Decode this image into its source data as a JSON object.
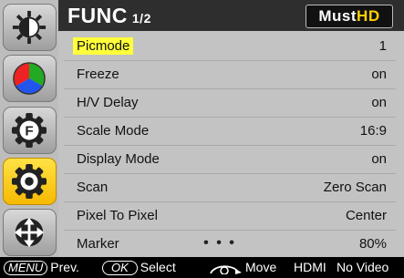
{
  "header": {
    "title": "FUNC",
    "page": "1/2",
    "logo_must": "Must",
    "logo_hd": "HD"
  },
  "sidebar": {
    "items": [
      {
        "icon": "brightness-icon",
        "active": false
      },
      {
        "icon": "color-wheel-icon",
        "active": false
      },
      {
        "icon": "function-gear-icon",
        "active": false
      },
      {
        "icon": "settings-gear-icon",
        "active": true
      },
      {
        "icon": "move-arrows-icon",
        "active": false
      }
    ]
  },
  "menu": {
    "rows": [
      {
        "label": "Picmode",
        "value": "1"
      },
      {
        "label": "Freeze",
        "value": "on"
      },
      {
        "label": "H/V Delay",
        "value": "on"
      },
      {
        "label": "Scale Mode",
        "value": "16:9"
      },
      {
        "label": "Display Mode",
        "value": "on"
      },
      {
        "label": "Scan",
        "value": "Zero Scan"
      },
      {
        "label": "Pixel To Pixel",
        "value": "Center"
      },
      {
        "label": "Marker",
        "value": "80%"
      }
    ],
    "selected_index": 0,
    "more_indicator": "• • •"
  },
  "footer": {
    "menu_key": "MENU",
    "menu_action": "Prev.",
    "ok_key": "OK",
    "ok_action": "Select",
    "rotary_action": "Move",
    "input_source": "HDMI",
    "signal_status": "No Video"
  },
  "colors": {
    "highlight": "#ffff3a",
    "active_tab": "#f5b800",
    "menu_bg": "#c3c3c3",
    "header_bg": "#2e2e2e",
    "logo_hd": "#ffd000"
  }
}
